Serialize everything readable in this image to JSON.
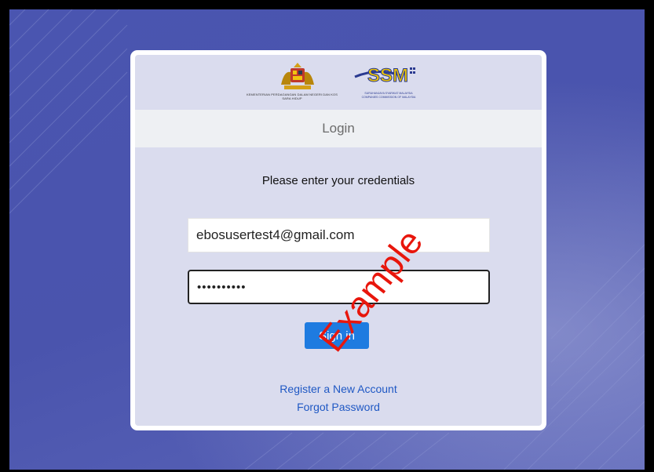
{
  "header": {
    "ministry_text": "KEMENTERIAN PERDAGANGAN DALAM NEGERI DAN KOS SARA HIDUP",
    "ssm_logo_text": "SSM",
    "ssm_org_text": "SURUHANJAYA SYARIKAT MALAYSIA COMPANIES COMMISSION OF MALAYSIA",
    "login_title": "Login"
  },
  "form": {
    "prompt": "Please enter your credentials",
    "email_value": "ebosusertest4@gmail.com",
    "password_mask": "••••••••••",
    "signin_label": "Sign in"
  },
  "links": {
    "register": "Register a New Account",
    "forgot": "Forgot Password"
  },
  "watermark": "Example",
  "colors": {
    "background": "#4550a8",
    "card": "#dadcee",
    "button": "#1e7be0",
    "link": "#1f58c4",
    "watermark": "#e8160c"
  }
}
